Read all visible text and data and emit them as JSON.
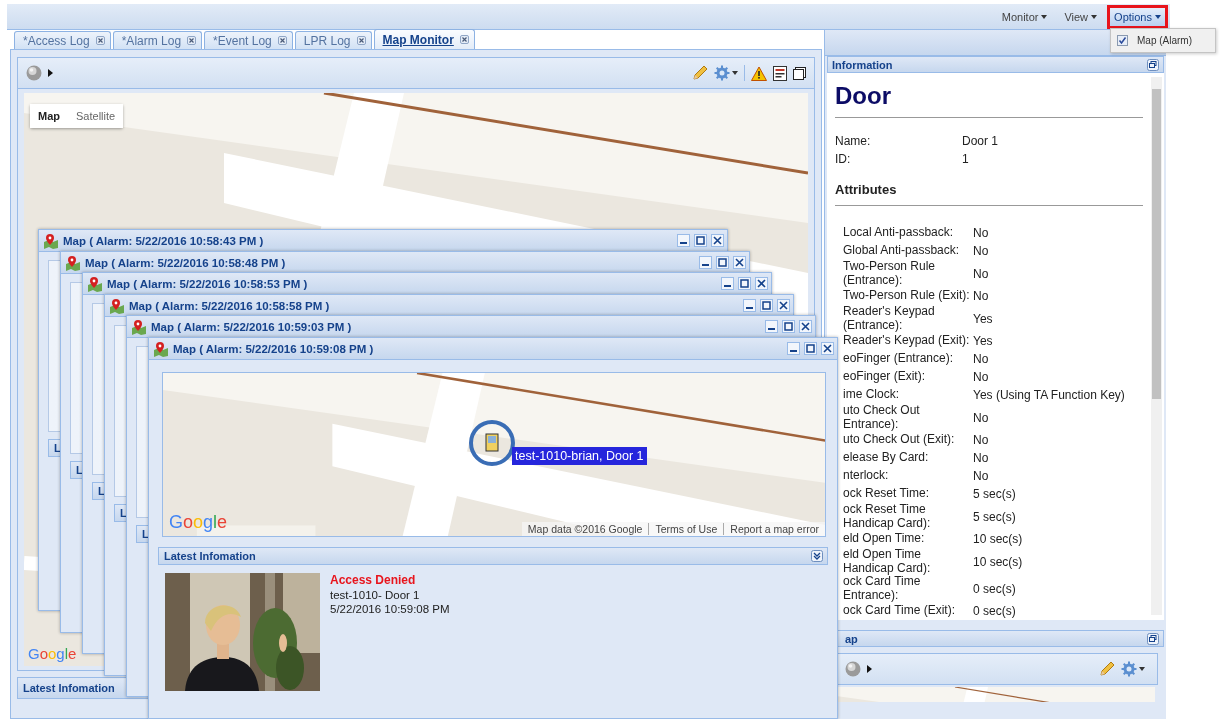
{
  "menu_bar": [
    {
      "label": "Monitor",
      "selected": false
    },
    {
      "label": "View",
      "selected": false
    },
    {
      "label": "Options",
      "selected": true
    }
  ],
  "options_menu": [
    {
      "label": "Map (Alarm)",
      "checked": true
    }
  ],
  "tabs": [
    {
      "label": "*Access Log",
      "selected": false
    },
    {
      "label": "*Alarm Log",
      "selected": false
    },
    {
      "label": "*Event Log",
      "selected": false
    },
    {
      "label": "LPR Log",
      "selected": false
    },
    {
      "label": "Map Monitor",
      "selected": true
    }
  ],
  "map_monitor": {
    "map_types": [
      {
        "label": "Map",
        "selected": true
      },
      {
        "label": "Satellite",
        "selected": false
      }
    ],
    "logo": "Google",
    "latest_title": "Latest Infomation"
  },
  "information": {
    "title": "Information",
    "heading": "Door",
    "fields": [
      {
        "label": "Name:",
        "value": "Door 1"
      },
      {
        "label": "ID:",
        "value": "1"
      }
    ],
    "attributes_title": "Attributes",
    "attributes": [
      {
        "label": "Local Anti-passback:",
        "value": "No"
      },
      {
        "label": "Global Anti-passback:",
        "value": "No"
      },
      {
        "label": "Two-Person Rule (Entrance):",
        "value": "No"
      },
      {
        "label": "Two-Person Rule (Exit):",
        "value": "No"
      },
      {
        "label": "Reader's Keypad (Entrance):",
        "value": "Yes"
      },
      {
        "label": "Reader's Keypad (Exit):",
        "value": "Yes"
      },
      {
        "label": "eoFinger (Entrance):",
        "value": "No"
      },
      {
        "label": "eoFinger (Exit):",
        "value": "No"
      },
      {
        "label": "ime Clock:",
        "value": "Yes (Using TA Function Key)"
      },
      {
        "label": "uto Check Out Entrance):",
        "value": "No"
      },
      {
        "label": "uto Check Out (Exit):",
        "value": "No"
      },
      {
        "label": "elease By Card:",
        "value": "No"
      },
      {
        "label": "nterlock:",
        "value": "No"
      },
      {
        "label": "ock Reset Time:",
        "value": "5 sec(s)"
      },
      {
        "label": "ock Reset Time Handicap Card):",
        "value": "5 sec(s)"
      },
      {
        "label": "eld Open Time:",
        "value": "10 sec(s)"
      },
      {
        "label": "eld Open Time Handicap Card):",
        "value": "10 sec(s)"
      },
      {
        "label": "ock Card Time Entrance):",
        "value": "0 sec(s)"
      },
      {
        "label": "ock Card Time (Exit):",
        "value": "0 sec(s)"
      }
    ]
  },
  "map_panel": {
    "title": "ap"
  },
  "alarm_windows": [
    {
      "title": "Map ( Alarm: 5/22/2016 10:58:43 PM )",
      "latest_title": "L"
    },
    {
      "title": "Map ( Alarm: 5/22/2016 10:58:48 PM )",
      "latest_title": "L"
    },
    {
      "title": "Map ( Alarm: 5/22/2016 10:58:53 PM )",
      "latest_title": "L"
    },
    {
      "title": "Map ( Alarm: 5/22/2016 10:58:58 PM )",
      "latest_title": "L"
    },
    {
      "title": "Map ( Alarm: 5/22/2016 10:59:03 PM )",
      "latest_title": "L"
    },
    {
      "title": "Map ( Alarm: 5/22/2016 10:59:08 PM )",
      "latest_title": "Latest Infomation",
      "marker_label": "test-1010-brian, Door 1",
      "logo": "Google",
      "attribution": "Map data ©2016 Google",
      "terms": "Terms of Use",
      "report": "Report a map error",
      "event": {
        "status": "Access Denied",
        "detail": "test-1010- Door 1",
        "time": "5/22/2016 10:59:08 PM"
      }
    }
  ]
}
